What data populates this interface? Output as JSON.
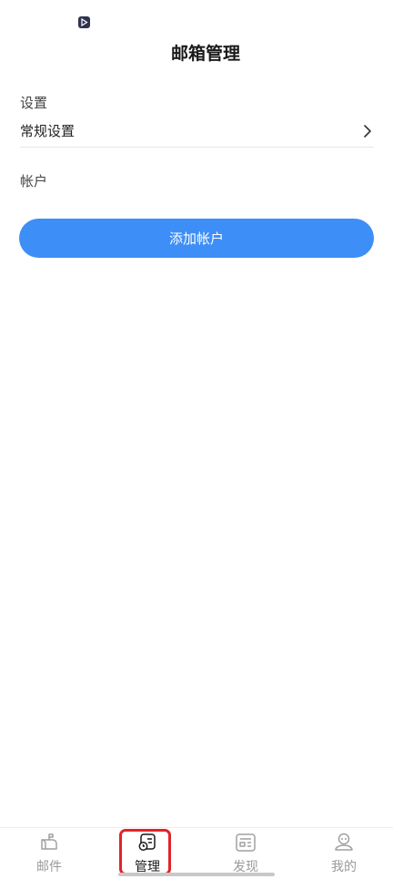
{
  "header": {
    "title": "邮箱管理",
    "status_icon": "play-icon"
  },
  "settings_section": {
    "label": "设置",
    "items": [
      {
        "label": "常规设置",
        "icon": "chevron-right-icon"
      }
    ]
  },
  "account_section": {
    "label": "帐户",
    "add_button_label": "添加帐户"
  },
  "tabbar": {
    "tabs": [
      {
        "label": "邮件",
        "icon": "mailbox-icon",
        "active": false
      },
      {
        "label": "管理",
        "icon": "manage-icon",
        "active": true
      },
      {
        "label": "发现",
        "icon": "news-icon",
        "active": false
      },
      {
        "label": "我的",
        "icon": "profile-icon",
        "active": false
      }
    ]
  },
  "colors": {
    "accent": "#3d8ef7",
    "highlight": "#e0242a",
    "inactive_text": "#9a9a9a",
    "active_text": "#1a1a1a"
  }
}
